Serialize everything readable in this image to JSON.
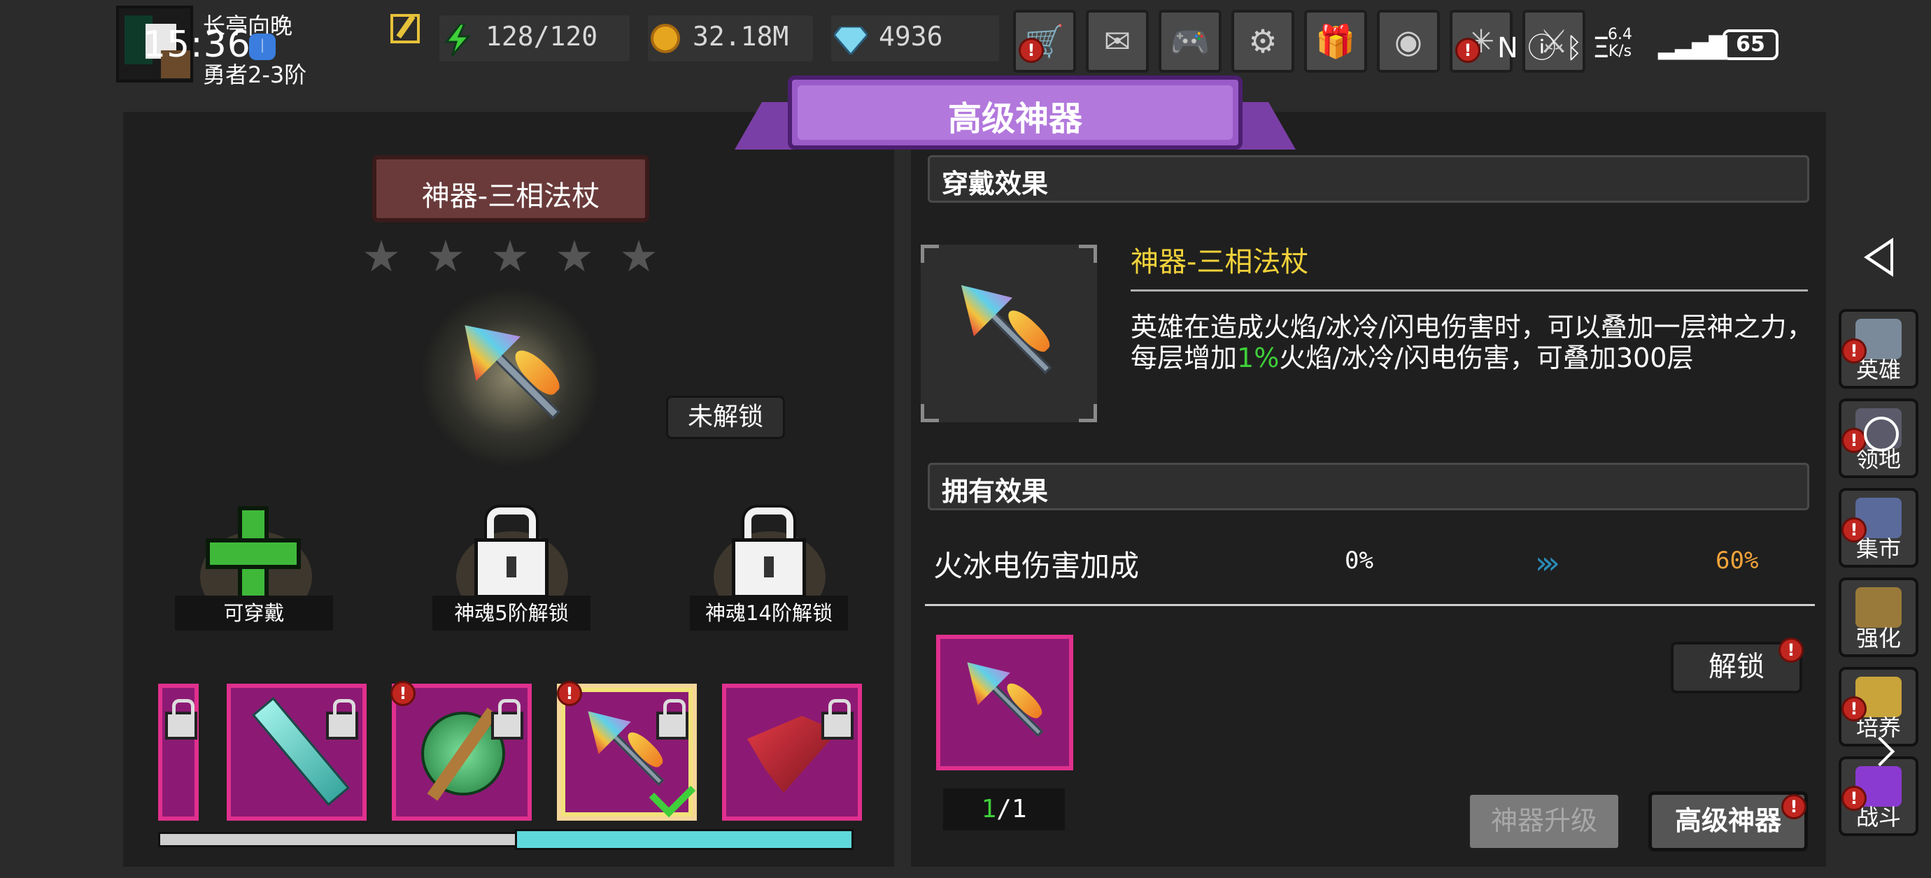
{
  "status_bar": {
    "clock": "15:36",
    "clock_badge": "ᛁ",
    "net_speed_value": "6.4",
    "net_speed_unit": "K/s",
    "battery": "65"
  },
  "player": {
    "name": "长亭向晚",
    "rank": "勇者2-3阶"
  },
  "resources": {
    "energy": "128/120",
    "coins": "32.18M",
    "gems": "4936"
  },
  "top_buttons": [
    {
      "name": "shop",
      "glyph": "🛒",
      "alert": true
    },
    {
      "name": "mail",
      "glyph": "✉",
      "alert": false
    },
    {
      "name": "gamepad",
      "glyph": "🎮",
      "alert": false
    },
    {
      "name": "settings",
      "glyph": "⚙",
      "alert": false
    },
    {
      "name": "gift",
      "glyph": "🎁",
      "alert": false
    },
    {
      "name": "wheel",
      "glyph": "◉",
      "alert": false
    },
    {
      "name": "fireworks",
      "glyph": "✳",
      "alert": true
    },
    {
      "name": "battle",
      "glyph": "⚔",
      "alert": false
    }
  ],
  "title": "高级神器",
  "artifact": {
    "name": "神器-三相法杖",
    "stars": 5,
    "status": "未解锁"
  },
  "slots": [
    {
      "label": "可穿戴",
      "type": "plus"
    },
    {
      "label": "神魂5阶解锁",
      "type": "lock"
    },
    {
      "label": "神魂14阶解锁",
      "type": "lock"
    }
  ],
  "wear_effect": {
    "header": "穿戴效果",
    "name": "神器-三相法杖",
    "desc_before": "英雄在造成火焰/冰冷/闪电伤害时，可以叠加一层神之力，每层增加",
    "desc_highlight": "1%",
    "desc_after": "火焰/冰冷/闪电伤害，可叠加300层"
  },
  "own_effect": {
    "header": "拥有效果",
    "stat": "火冰电伤害加成",
    "from": "0%",
    "to": "60%",
    "count_have": "1",
    "count_sep": "/",
    "count_total": "1"
  },
  "buttons": {
    "unlock": "解锁",
    "upgrade": "神器升级",
    "advanced": "高级神器"
  },
  "side_nav": [
    {
      "label": "英雄",
      "color": "#7a8a9a",
      "alert": true
    },
    {
      "label": "领地",
      "color": "#5a5a6a",
      "alert": true
    },
    {
      "label": "集市",
      "color": "#5a6a9a",
      "alert": true
    },
    {
      "label": "强化",
      "color": "#9a7a3a",
      "alert": false
    },
    {
      "label": "培养",
      "color": "#c8a43a",
      "alert": true
    },
    {
      "label": "战斗",
      "color": "#8a3ad0",
      "alert": true
    }
  ],
  "colors": {
    "ribbon": "#9a5bc8",
    "thumb_bg": "#8c1a74",
    "highlight_yellow": "#f2d23a",
    "green": "#3fcf3a",
    "orange": "#f2a43a"
  }
}
